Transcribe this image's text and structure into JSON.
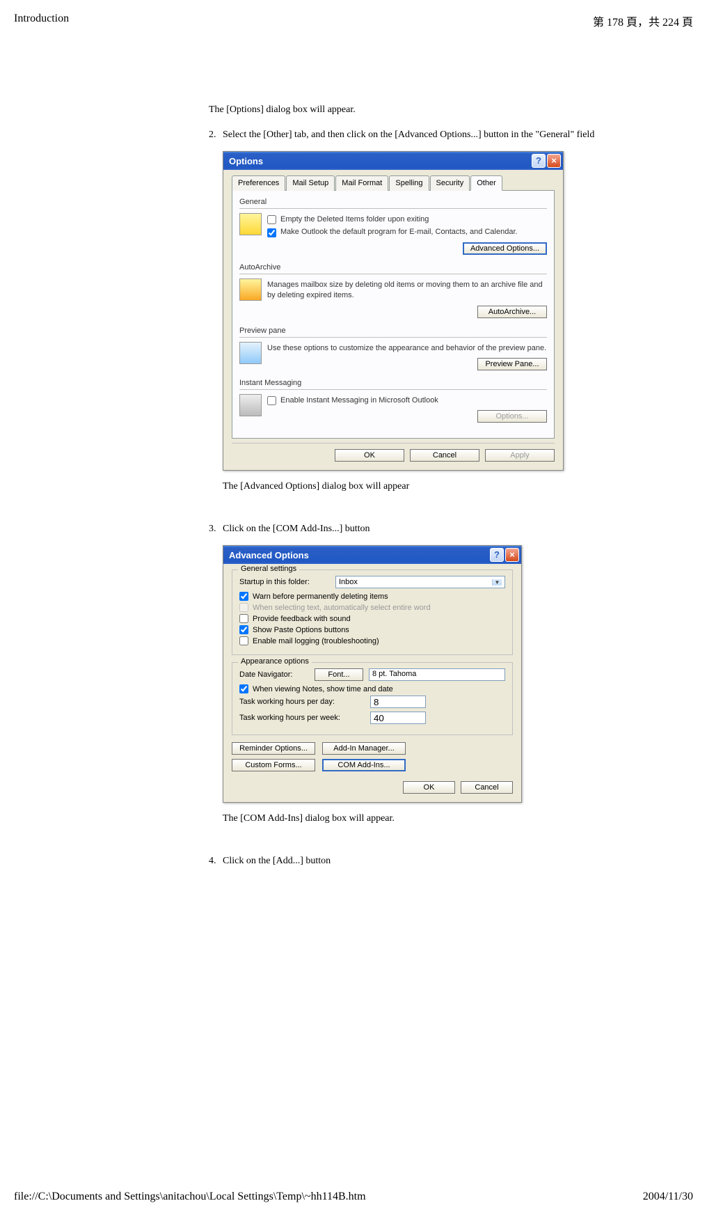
{
  "header": {
    "title": "Introduction",
    "page_label": "第 178 頁，共 224 頁"
  },
  "content": {
    "intro_text": "The [Options] dialog box will appear.",
    "step2_num": "2.",
    "step2_text": "Select the [Other] tab, and then click on the [Advanced Options...] button in the \"General\" field",
    "step2_result": "The [Advanced Options] dialog box will appear",
    "step3_num": "3.",
    "step3_text": "Click on the [COM Add-Ins...] button",
    "step3_result": "The [COM Add-Ins] dialog box will appear.",
    "step4_num": "4.",
    "step4_text": "Click on the [Add...] button"
  },
  "options_dialog": {
    "title": "Options",
    "tabs": [
      "Preferences",
      "Mail Setup",
      "Mail Format",
      "Spelling",
      "Security",
      "Other"
    ],
    "general": {
      "label": "General",
      "check1": "Empty the Deleted Items folder upon exiting",
      "check2": "Make Outlook the default program for E-mail, Contacts, and Calendar.",
      "btn": "Advanced Options..."
    },
    "autoarchive": {
      "label": "AutoArchive",
      "desc": "Manages mailbox size by deleting old items or moving them to an archive file and by deleting expired items.",
      "btn": "AutoArchive..."
    },
    "preview": {
      "label": "Preview pane",
      "desc": "Use these options to customize the appearance and behavior of the preview pane.",
      "btn": "Preview Pane..."
    },
    "im": {
      "label": "Instant Messaging",
      "check": "Enable Instant Messaging in Microsoft Outlook",
      "btn": "Options..."
    },
    "ok": "OK",
    "cancel": "Cancel",
    "apply": "Apply"
  },
  "adv_dialog": {
    "title": "Advanced Options",
    "gen": {
      "label": "General settings",
      "startup_label": "Startup in this folder:",
      "startup_value": "Inbox",
      "c1": "Warn before permanently deleting items",
      "c2": "When selecting text, automatically select entire word",
      "c3": "Provide feedback with sound",
      "c4": "Show Paste Options buttons",
      "c5": "Enable mail logging (troubleshooting)"
    },
    "app": {
      "label": "Appearance options",
      "nav_label": "Date Navigator:",
      "font_btn": "Font...",
      "font_val": "8 pt. Tahoma",
      "notes_check": "When viewing Notes, show time and date",
      "hours_day_label": "Task working hours per day:",
      "hours_day_val": "8",
      "hours_week_label": "Task working hours per week:",
      "hours_week_val": "40"
    },
    "buttons": {
      "reminder": "Reminder Options...",
      "addin_mgr": "Add-In Manager...",
      "custom": "Custom Forms...",
      "com": "COM Add-Ins..."
    },
    "ok": "OK",
    "cancel": "Cancel"
  },
  "footer": {
    "path": "file://C:\\Documents and Settings\\anitachou\\Local Settings\\Temp\\~hh114B.htm",
    "date": "2004/11/30"
  }
}
